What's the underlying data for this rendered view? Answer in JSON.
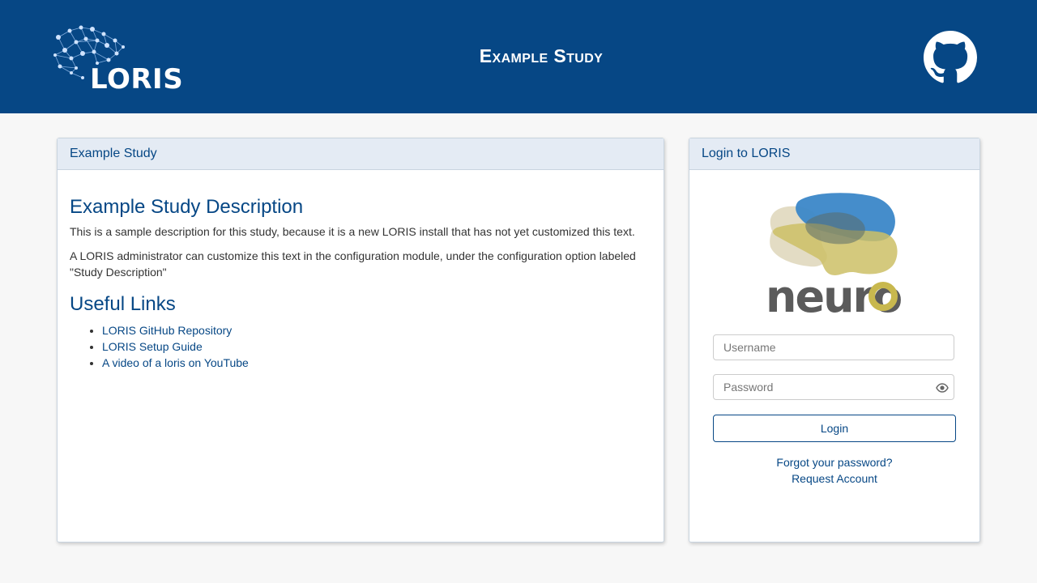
{
  "header": {
    "logo_text": "LORIS",
    "site_title": "Example Study",
    "github_icon": "github-icon",
    "background_color": "#064785"
  },
  "study_panel": {
    "heading": "Example Study",
    "description_title": "Example Study Description",
    "paragraphs": [
      "This is a sample description for this study, because it is a new LORIS install that has not yet customized this text.",
      "A LORIS administrator can customize this text in the configuration module, under the configuration option labeled \"Study Description\""
    ],
    "links_title": "Useful Links",
    "links": [
      "LORIS GitHub Repository",
      "LORIS Setup Guide",
      "A video of a loris on YouTube"
    ]
  },
  "login_panel": {
    "heading": "Login to LORIS",
    "logo_text": "neuro",
    "username_placeholder": "Username",
    "password_placeholder": "Password",
    "password_toggle_icon": "eye-icon",
    "login_label": "Login",
    "forgot_password": "Forgot your password?",
    "request_account": "Request Account"
  },
  "colors": {
    "brand_blue": "#064785",
    "panel_heading_bg": "#e4ebf4",
    "page_bg": "#f7f7f7"
  }
}
